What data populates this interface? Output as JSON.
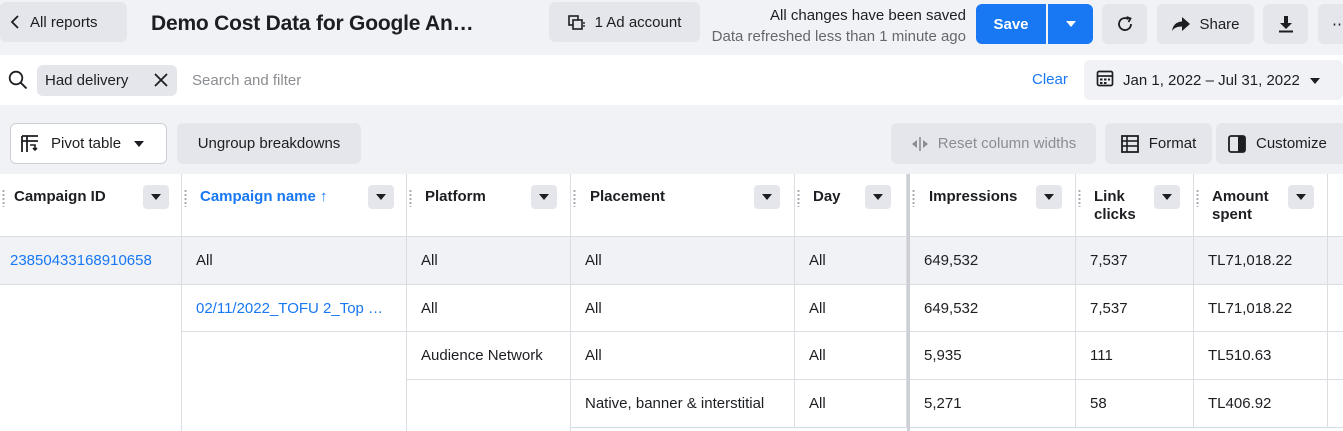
{
  "header": {
    "back_label": "All reports",
    "title": "Demo Cost Data for Google An…",
    "ad_account_label": "1 Ad account",
    "save_status": "All changes have been saved",
    "refresh_status": "Data refreshed less than 1 minute ago",
    "save_label": "Save",
    "share_label": "Share",
    "more_label": "⋯"
  },
  "search": {
    "chip_label": "Had delivery",
    "placeholder": "Search and filter",
    "clear_label": "Clear",
    "date_range": "Jan 1, 2022 – Jul 31, 2022"
  },
  "toolbar": {
    "pivot_label": "Pivot table",
    "ungroup_label": "Ungroup breakdowns",
    "reset_label": "Reset column widths",
    "format_label": "Format",
    "customize_label": "Customize"
  },
  "table": {
    "columns": [
      {
        "label": "Campaign ID"
      },
      {
        "label": "Campaign name ↑"
      },
      {
        "label": "Platform"
      },
      {
        "label": "Placement"
      },
      {
        "label": "Day"
      },
      {
        "label": "Impressions"
      },
      {
        "label": "Link clicks"
      },
      {
        "label": "Amount spent"
      }
    ],
    "rows": [
      {
        "campaign_id": "23850433168910658",
        "campaign_name": "All",
        "platform": "All",
        "placement": "All",
        "day": "All",
        "impressions": "649,532",
        "link_clicks": "7,537",
        "amount_spent": "TL71,018.22"
      },
      {
        "campaign_name": "02/11/2022_TOFU 2_Top …",
        "platform": "All",
        "placement": "All",
        "day": "All",
        "impressions": "649,532",
        "link_clicks": "7,537",
        "amount_spent": "TL71,018.22"
      },
      {
        "platform": "Audience Network",
        "placement": "All",
        "day": "All",
        "impressions": "5,935",
        "link_clicks": "111",
        "amount_spent": "TL510.63"
      },
      {
        "placement": "Native, banner & interstitial",
        "day": "All",
        "impressions": "5,271",
        "link_clicks": "58",
        "amount_spent": "TL406.92"
      }
    ]
  },
  "colors": {
    "accent": "#1877f2",
    "link": "#1877f2",
    "row_highlight": "#f0f2f5"
  }
}
